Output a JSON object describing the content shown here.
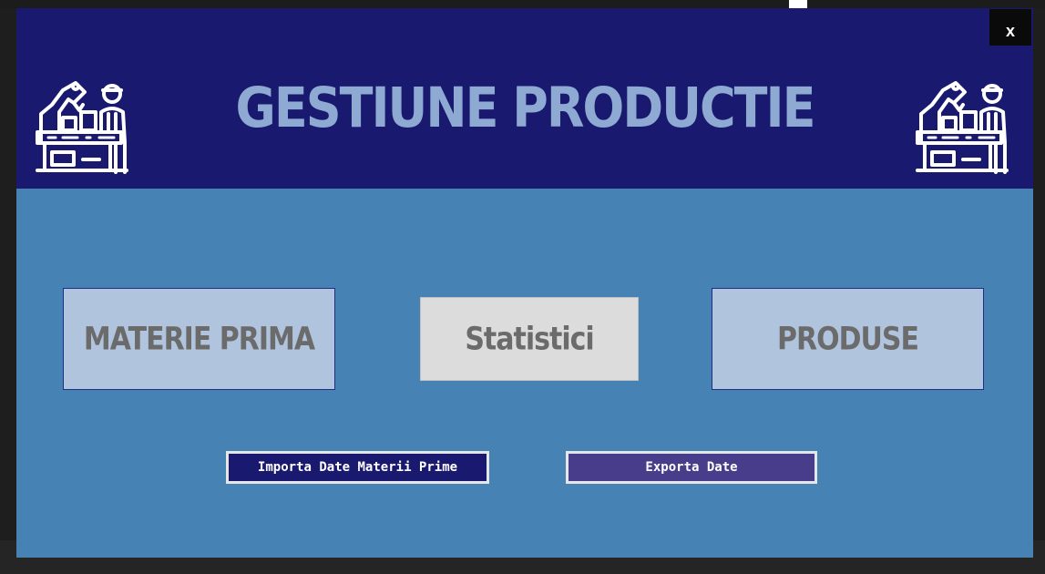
{
  "window": {
    "title": "GESTIUNE PRODUCTIE",
    "close_label": "x"
  },
  "main": {
    "buttons": {
      "materie_prima": "MATERIE PRIMA",
      "statistici": "Statistici",
      "produse": "PRODUSE"
    },
    "actions": {
      "import_label": "Importa Date Materii Prime",
      "export_label": "Exporta Date"
    }
  },
  "icons": {
    "logo": "factory-worker-conveyor-icon",
    "scroll_up": "chevron-up-icon"
  },
  "colors": {
    "header_bg": "#191970",
    "body_bg": "#4682b4",
    "title_color": "#8eaad2",
    "primary_button": "#b0c4de",
    "secondary_button": "#dcdcdc",
    "import_button": "#191970",
    "export_button": "#483d8b"
  }
}
